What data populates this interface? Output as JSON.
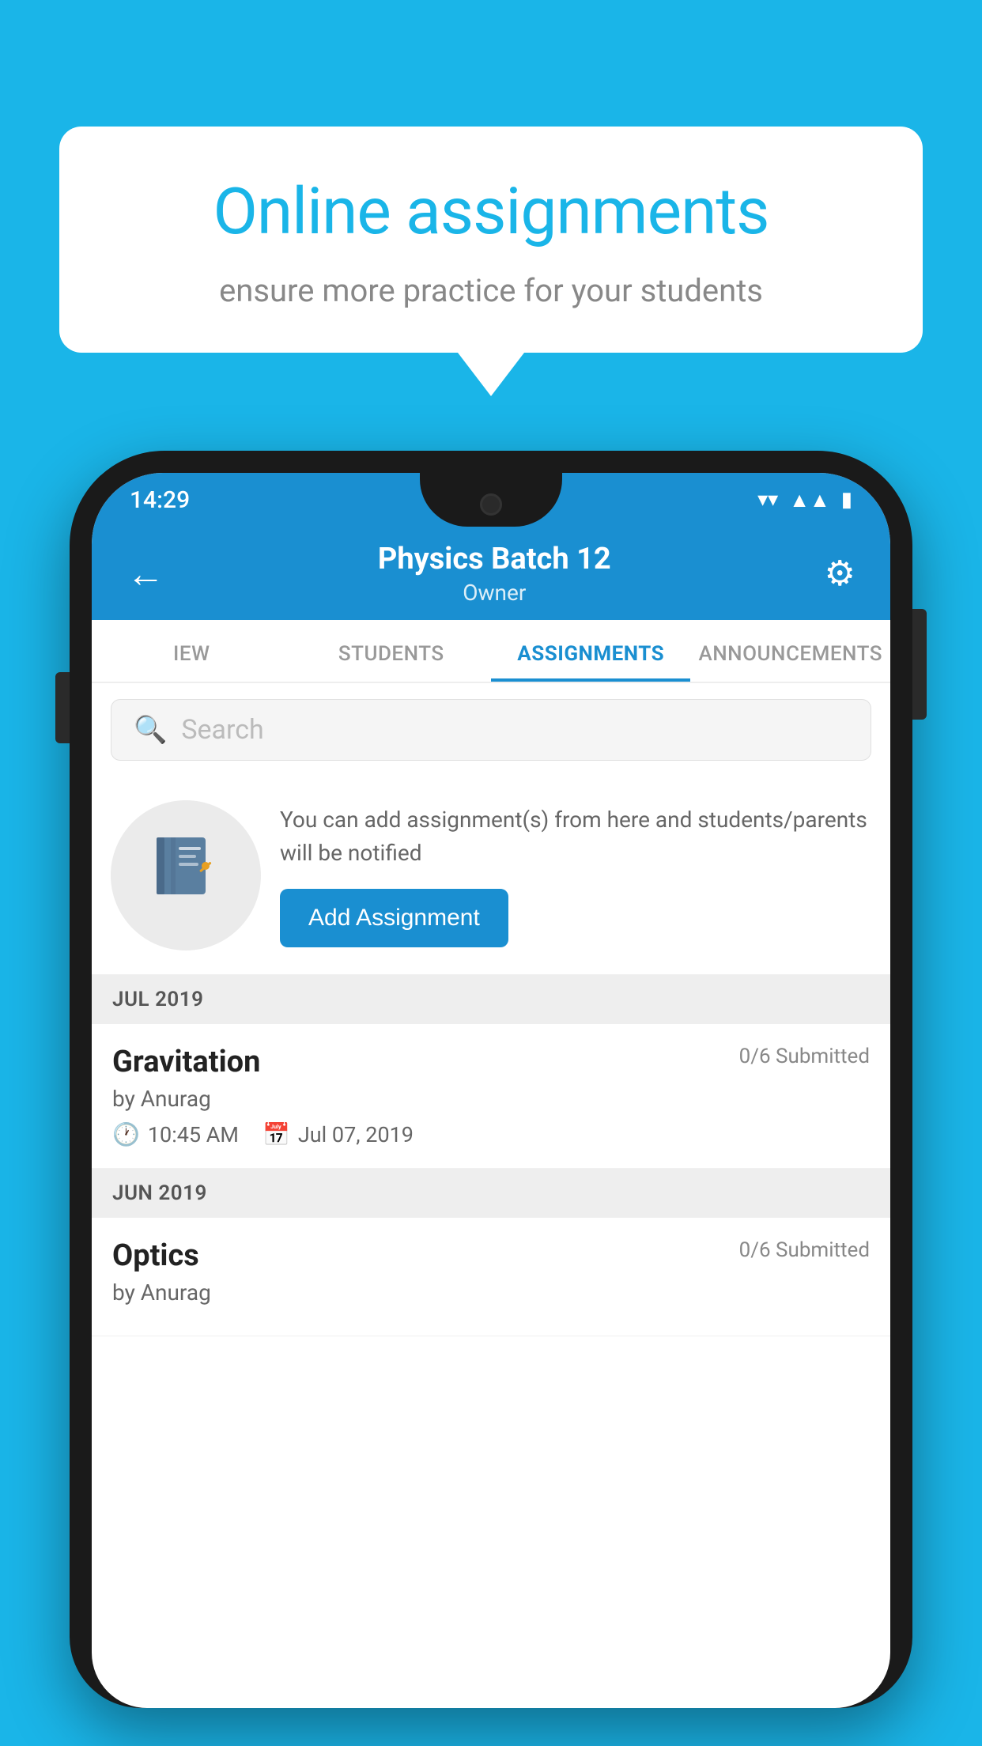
{
  "background": {
    "color": "#1ab5e8"
  },
  "speech_bubble": {
    "title": "Online assignments",
    "subtitle": "ensure more practice for your students"
  },
  "status_bar": {
    "time": "14:29",
    "wifi_icon": "wifi",
    "signal_icon": "signal",
    "battery_icon": "battery"
  },
  "app_bar": {
    "title": "Physics Batch 12",
    "subtitle": "Owner",
    "back_icon": "←",
    "settings_icon": "⚙"
  },
  "tabs": [
    {
      "id": "view",
      "label": "IEW",
      "active": false
    },
    {
      "id": "students",
      "label": "STUDENTS",
      "active": false
    },
    {
      "id": "assignments",
      "label": "ASSIGNMENTS",
      "active": true
    },
    {
      "id": "announcements",
      "label": "ANNOUNCEMENTS",
      "active": false
    }
  ],
  "search": {
    "placeholder": "Search"
  },
  "empty_state": {
    "icon": "📓",
    "description": "You can add assignment(s) from here and students/parents will be notified",
    "button_label": "Add Assignment"
  },
  "sections": [
    {
      "month": "JUL 2019",
      "assignments": [
        {
          "title": "Gravitation",
          "submitted": "0/6 Submitted",
          "author": "by Anurag",
          "time": "10:45 AM",
          "date": "Jul 07, 2019"
        }
      ]
    },
    {
      "month": "JUN 2019",
      "assignments": [
        {
          "title": "Optics",
          "submitted": "0/6 Submitted",
          "author": "by Anurag",
          "time": "",
          "date": ""
        }
      ]
    }
  ]
}
